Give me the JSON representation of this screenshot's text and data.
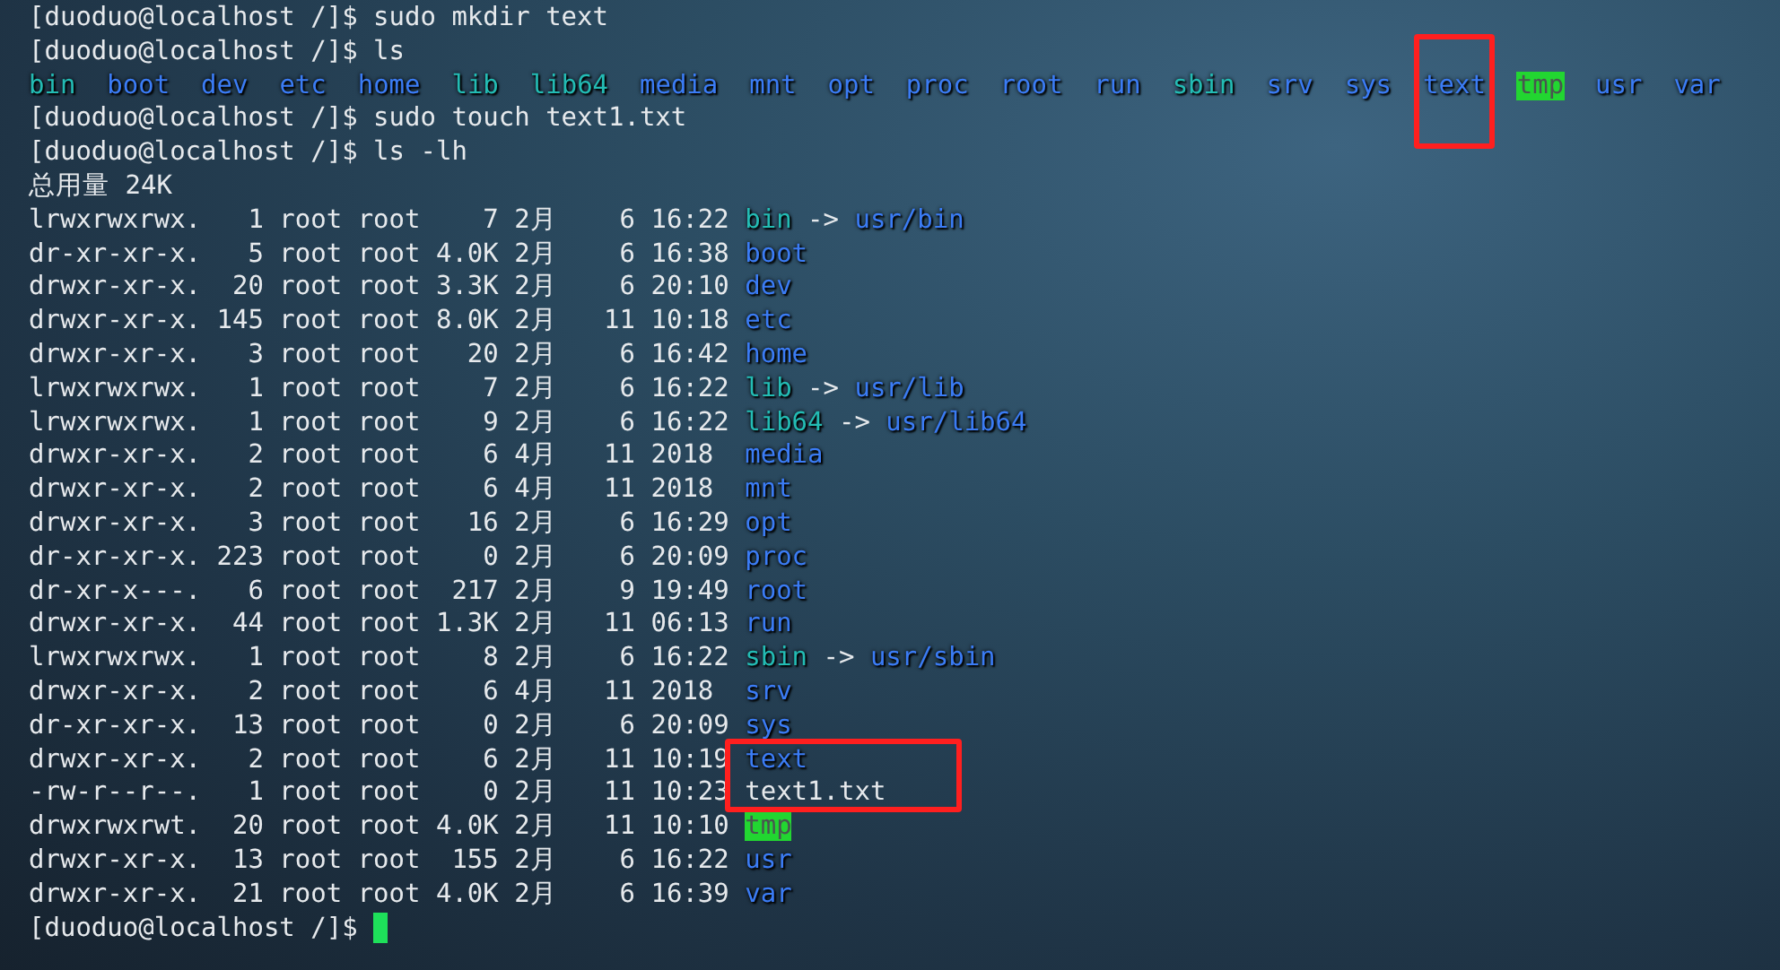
{
  "terminal": {
    "lines": [
      {
        "kind": "prompt",
        "prompt": "[duoduo@localhost /]$",
        "command": "sudo mkdir text"
      },
      {
        "kind": "prompt",
        "prompt": "[duoduo@localhost /]$",
        "command": "ls"
      },
      {
        "kind": "ls",
        "items": [
          {
            "name": "bin",
            "kind": "link",
            "highlighted": false
          },
          {
            "name": "boot",
            "kind": "dir",
            "highlighted": false
          },
          {
            "name": "dev",
            "kind": "dir",
            "highlighted": false
          },
          {
            "name": "etc",
            "kind": "dir",
            "highlighted": false
          },
          {
            "name": "home",
            "kind": "dir",
            "highlighted": false
          },
          {
            "name": "lib",
            "kind": "link",
            "highlighted": false
          },
          {
            "name": "lib64",
            "kind": "link",
            "highlighted": false
          },
          {
            "name": "media",
            "kind": "dir",
            "highlighted": false
          },
          {
            "name": "mnt",
            "kind": "dir",
            "highlighted": false
          },
          {
            "name": "opt",
            "kind": "dir",
            "highlighted": false
          },
          {
            "name": "proc",
            "kind": "dir",
            "highlighted": false
          },
          {
            "name": "root",
            "kind": "dir",
            "highlighted": false
          },
          {
            "name": "run",
            "kind": "dir",
            "highlighted": false
          },
          {
            "name": "sbin",
            "kind": "link",
            "highlighted": false
          },
          {
            "name": "srv",
            "kind": "dir",
            "highlighted": false
          },
          {
            "name": "sys",
            "kind": "dir",
            "highlighted": false
          },
          {
            "name": "text",
            "kind": "dir",
            "highlighted": true
          },
          {
            "name": "tmp",
            "kind": "sticky",
            "highlighted": false
          },
          {
            "name": "usr",
            "kind": "dir",
            "highlighted": false
          },
          {
            "name": "var",
            "kind": "dir",
            "highlighted": false
          }
        ]
      },
      {
        "kind": "prompt",
        "prompt": "[duoduo@localhost /]$",
        "command": "sudo touch text1.txt"
      },
      {
        "kind": "prompt",
        "prompt": "[duoduo@localhost /]$",
        "command": "ls -lh"
      },
      {
        "kind": "text",
        "text": "总用量 24K"
      },
      {
        "kind": "listing",
        "rows": [
          {
            "meta": "lrwxrwxrwx.   1 root root    7 2月    6 16:22",
            "name": "bin",
            "kind": "link",
            "arrow": "->",
            "target": "usr/bin",
            "highlighted": false
          },
          {
            "meta": "dr-xr-xr-x.   5 root root 4.0K 2月    6 16:38",
            "name": "boot",
            "kind": "dir",
            "highlighted": false
          },
          {
            "meta": "drwxr-xr-x.  20 root root 3.3K 2月    6 20:10",
            "name": "dev",
            "kind": "dir",
            "highlighted": false
          },
          {
            "meta": "drwxr-xr-x. 145 root root 8.0K 2月   11 10:18",
            "name": "etc",
            "kind": "dir",
            "highlighted": false
          },
          {
            "meta": "drwxr-xr-x.   3 root root   20 2月    6 16:42",
            "name": "home",
            "kind": "dir",
            "highlighted": false
          },
          {
            "meta": "lrwxrwxrwx.   1 root root    7 2月    6 16:22",
            "name": "lib",
            "kind": "link",
            "arrow": "->",
            "target": "usr/lib",
            "highlighted": false
          },
          {
            "meta": "lrwxrwxrwx.   1 root root    9 2月    6 16:22",
            "name": "lib64",
            "kind": "link",
            "arrow": "->",
            "target": "usr/lib64",
            "highlighted": false
          },
          {
            "meta": "drwxr-xr-x.   2 root root    6 4月   11 2018",
            "name": "media",
            "kind": "dir",
            "highlighted": false
          },
          {
            "meta": "drwxr-xr-x.   2 root root    6 4月   11 2018",
            "name": "mnt",
            "kind": "dir",
            "highlighted": false
          },
          {
            "meta": "drwxr-xr-x.   3 root root   16 2月    6 16:29",
            "name": "opt",
            "kind": "dir",
            "highlighted": false
          },
          {
            "meta": "dr-xr-xr-x. 223 root root    0 2月    6 20:09",
            "name": "proc",
            "kind": "dir",
            "highlighted": false
          },
          {
            "meta": "dr-xr-x---.   6 root root  217 2月    9 19:49",
            "name": "root",
            "kind": "dir",
            "highlighted": false
          },
          {
            "meta": "drwxr-xr-x.  44 root root 1.3K 2月   11 06:13",
            "name": "run",
            "kind": "dir",
            "highlighted": false
          },
          {
            "meta": "lrwxrwxrwx.   1 root root    8 2月    6 16:22",
            "name": "sbin",
            "kind": "link",
            "arrow": "->",
            "target": "usr/sbin",
            "highlighted": false
          },
          {
            "meta": "drwxr-xr-x.   2 root root    6 4月   11 2018",
            "name": "srv",
            "kind": "dir",
            "highlighted": false
          },
          {
            "meta": "dr-xr-xr-x.  13 root root    0 2月    6 20:09",
            "name": "sys",
            "kind": "dir",
            "highlighted": false
          },
          {
            "meta": "drwxr-xr-x.   2 root root    6 2月   11 10:19",
            "name": "text",
            "kind": "dir",
            "highlighted": true
          },
          {
            "meta": "-rw-r--r--.   1 root root    0 2月   11 10:23",
            "name": "text1.txt",
            "kind": "file",
            "highlighted": true
          },
          {
            "meta": "drwxrwxrwt.  20 root root 4.0K 2月   11 10:10",
            "name": "tmp",
            "kind": "sticky",
            "highlighted": false
          },
          {
            "meta": "drwxr-xr-x.  13 root root  155 2月    6 16:22",
            "name": "usr",
            "kind": "dir",
            "highlighted": false
          },
          {
            "meta": "drwxr-xr-x.  21 root root 4.0K 2月    6 16:39",
            "name": "var",
            "kind": "dir",
            "highlighted": false
          }
        ]
      },
      {
        "kind": "prompt",
        "prompt": "[duoduo@localhost /]$",
        "cursor": true
      }
    ]
  }
}
